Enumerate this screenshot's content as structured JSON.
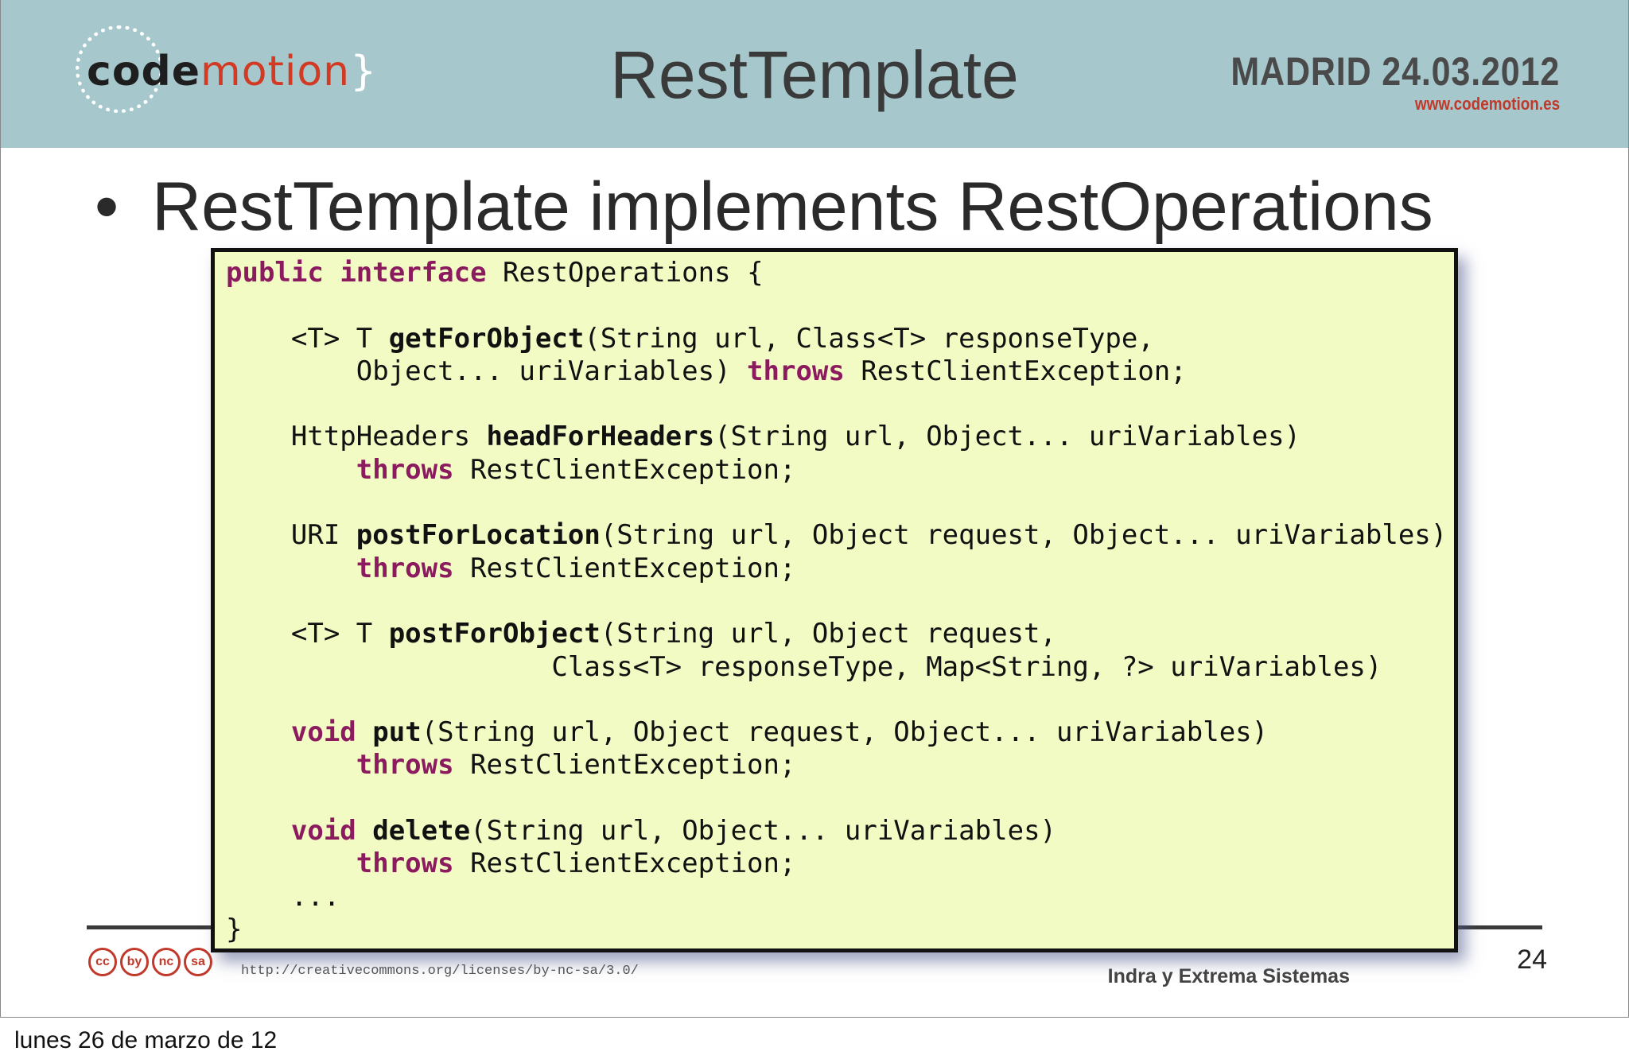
{
  "header": {
    "title": "RestTemplate",
    "logo_text_a": "code",
    "logo_text_b": "motion",
    "logo_brace": "}",
    "event_city_date": "MADRID 24.03.2012",
    "event_url": "www.codemotion.es"
  },
  "bullet": {
    "marker": "•",
    "text": "RestTemplate implements RestOperations"
  },
  "code_lines": [
    [
      {
        "t": "public",
        "c": "kw"
      },
      {
        "t": " "
      },
      {
        "t": "interface",
        "c": "kw"
      },
      {
        "t": " RestOperations {"
      }
    ],
    [
      {
        "t": ""
      }
    ],
    [
      {
        "t": "    <T> T "
      },
      {
        "t": "getForObject",
        "c": "fn"
      },
      {
        "t": "(String url, Class<T> responseType,"
      }
    ],
    [
      {
        "t": "        Object... uriVariables) "
      },
      {
        "t": "throws",
        "c": "kw"
      },
      {
        "t": " RestClientException;"
      }
    ],
    [
      {
        "t": ""
      }
    ],
    [
      {
        "t": "    HttpHeaders "
      },
      {
        "t": "headForHeaders",
        "c": "fn"
      },
      {
        "t": "(String url, Object... uriVariables)"
      }
    ],
    [
      {
        "t": "        "
      },
      {
        "t": "throws",
        "c": "kw"
      },
      {
        "t": " RestClientException;"
      }
    ],
    [
      {
        "t": ""
      }
    ],
    [
      {
        "t": "    URI "
      },
      {
        "t": "postForLocation",
        "c": "fn"
      },
      {
        "t": "(String url, Object request, Object... uriVariables)"
      }
    ],
    [
      {
        "t": "        "
      },
      {
        "t": "throws",
        "c": "kw"
      },
      {
        "t": " RestClientException;"
      }
    ],
    [
      {
        "t": ""
      }
    ],
    [
      {
        "t": "    <T> T "
      },
      {
        "t": "postForObject",
        "c": "fn"
      },
      {
        "t": "(String url, Object request,"
      }
    ],
    [
      {
        "t": "                    Class<T> responseType, Map<String, ?> uriVariables)"
      }
    ],
    [
      {
        "t": ""
      }
    ],
    [
      {
        "t": "    "
      },
      {
        "t": "void",
        "c": "kw"
      },
      {
        "t": " "
      },
      {
        "t": "put",
        "c": "fn"
      },
      {
        "t": "(String url, Object request, Object... uriVariables)"
      }
    ],
    [
      {
        "t": "        "
      },
      {
        "t": "throws",
        "c": "kw"
      },
      {
        "t": " RestClientException;"
      }
    ],
    [
      {
        "t": ""
      }
    ],
    [
      {
        "t": "    "
      },
      {
        "t": "void",
        "c": "kw"
      },
      {
        "t": " "
      },
      {
        "t": "delete",
        "c": "fn"
      },
      {
        "t": "(String url, Object... uriVariables)"
      }
    ],
    [
      {
        "t": "        "
      },
      {
        "t": "throws",
        "c": "kw"
      },
      {
        "t": " RestClientException;"
      }
    ],
    [
      {
        "t": "    ..."
      }
    ],
    [
      {
        "t": "}"
      }
    ]
  ],
  "footer": {
    "cc_icons": [
      "cc",
      "by",
      "nc",
      "sa"
    ],
    "license_url": "http://creativecommons.org/licenses/by-nc-sa/3.0/",
    "authors_company": "Indra y Extrema Sistemas",
    "page_number": "24"
  },
  "date_caption": "lunes 26 de marzo de 12",
  "colors": {
    "header_bg": "#a6c7cb",
    "code_bg": "#f3fbc5",
    "keyword": "#8b1a5e",
    "brand_red": "#c0392b"
  }
}
